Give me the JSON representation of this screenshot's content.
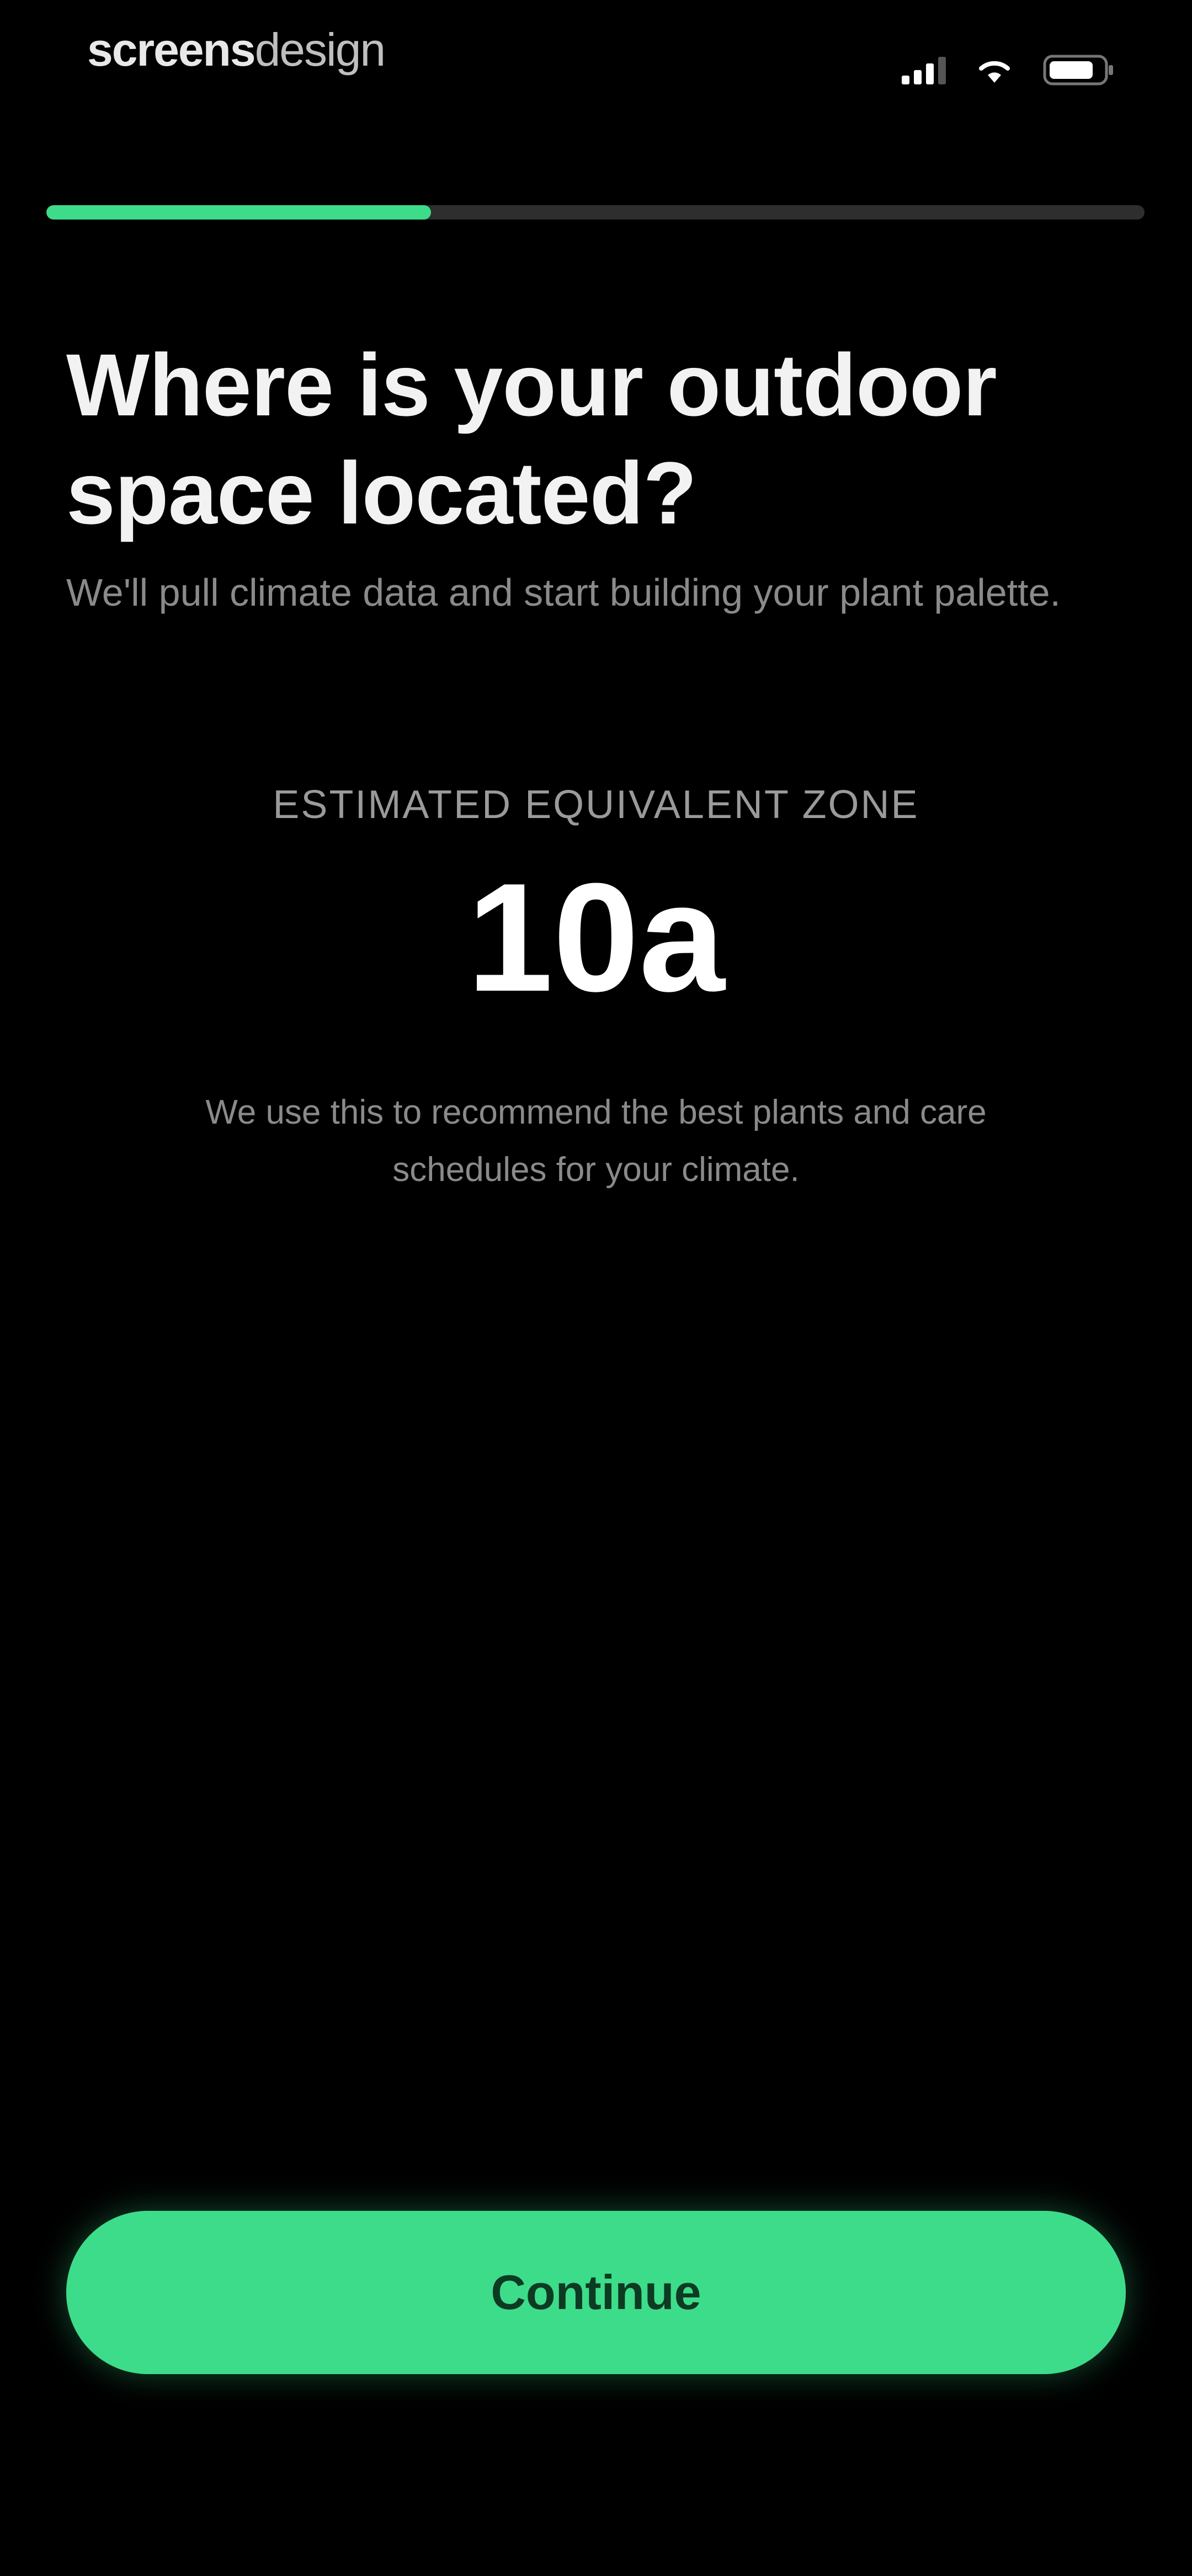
{
  "status_bar": {
    "brand_bold": "screens",
    "brand_light": "design",
    "icons": [
      "signal-icon",
      "wifi-icon",
      "battery-icon"
    ]
  },
  "progress": {
    "fraction": 0.35,
    "color": "#3ddc8a",
    "track_color": "#2e2e2e"
  },
  "question": {
    "title": "Where is your outdoor space located?",
    "subtitle": "We'll pull climate data and start building your plant palette."
  },
  "zone": {
    "label": "ESTIMATED EQUIVALENT ZONE",
    "value": "10a",
    "note": "We use this to recommend the best plants and care schedules for your climate."
  },
  "actions": {
    "continue_label": "Continue"
  },
  "colors": {
    "background": "#000000",
    "accent": "#3ddc8a"
  }
}
